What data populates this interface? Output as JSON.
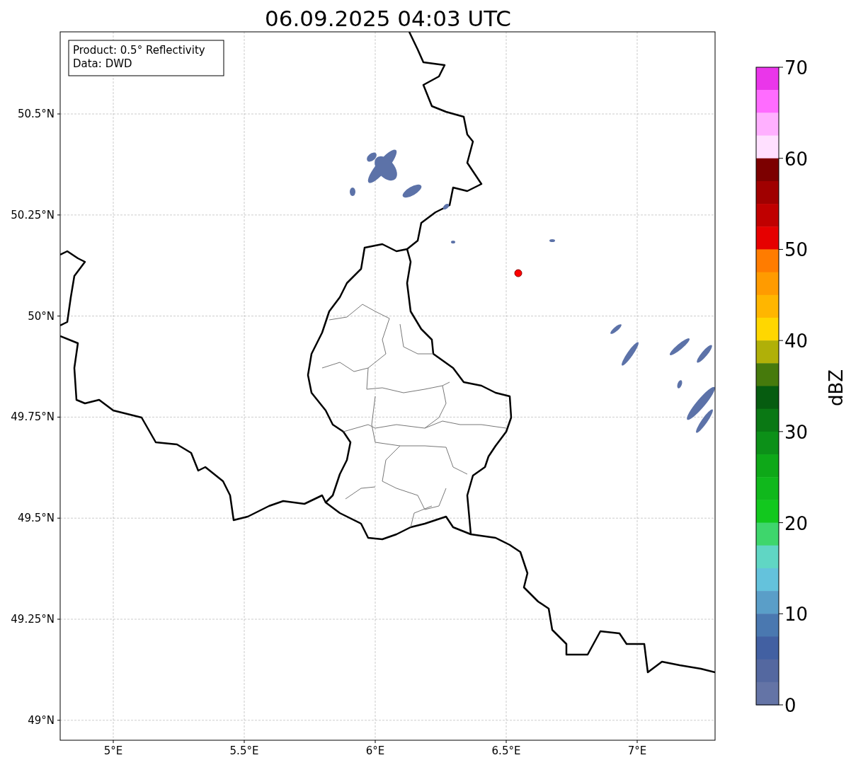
{
  "title": "06.09.2025 04:03 UTC",
  "info_box": {
    "lines": [
      "Product: 0.5° Reflectivity",
      "Data: DWD"
    ]
  },
  "x_ticks": [
    "5°E",
    "5.5°E",
    "6°E",
    "6.5°E",
    "7°E"
  ],
  "y_ticks": [
    "50.5°N",
    "50.25°N",
    "50°N",
    "49.75°N",
    "49.5°N",
    "49.25°N",
    "49°N"
  ],
  "colorbar": {
    "label": "dBZ",
    "ticks": [
      "70",
      "60",
      "50",
      "40",
      "30",
      "20",
      "10",
      "0"
    ],
    "segments": [
      {
        "color": "#ea36ea"
      },
      {
        "color": "#ff6cff"
      },
      {
        "color": "#ffb0ff"
      },
      {
        "color": "#ffe0ff"
      },
      {
        "color": "#7c0000"
      },
      {
        "color": "#a00000"
      },
      {
        "color": "#c00000"
      },
      {
        "color": "#e60000"
      },
      {
        "color": "#ff7c00"
      },
      {
        "color": "#ff9b00"
      },
      {
        "color": "#ffb600"
      },
      {
        "color": "#ffd700"
      },
      {
        "color": "#b0b008"
      },
      {
        "color": "#467a0c"
      },
      {
        "color": "#065c10"
      },
      {
        "color": "#0a7814"
      },
      {
        "color": "#0c9018"
      },
      {
        "color": "#0ea818"
      },
      {
        "color": "#10b81c"
      },
      {
        "color": "#12c81e"
      },
      {
        "color": "#3ed66c"
      },
      {
        "color": "#60d6c4"
      },
      {
        "color": "#64c2dc"
      },
      {
        "color": "#5a9ec8"
      },
      {
        "color": "#4a78b0"
      },
      {
        "color": "#4260a2"
      },
      {
        "color": "#5468a0"
      },
      {
        "color": "#6474a6"
      }
    ]
  }
}
